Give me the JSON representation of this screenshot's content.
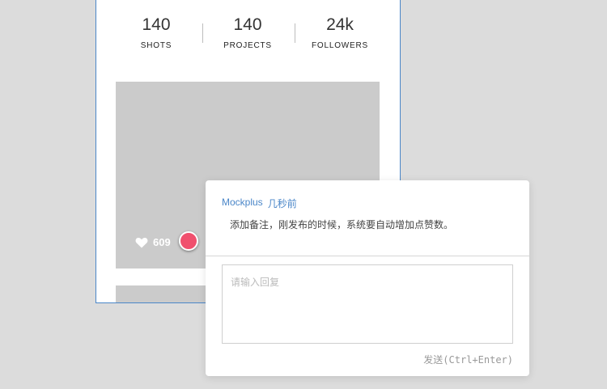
{
  "stats": [
    {
      "value": "140",
      "label": "SHOTS"
    },
    {
      "value": "140",
      "label": "PROJECTS"
    },
    {
      "value": "24k",
      "label": "FOLLOWERS"
    }
  ],
  "shot": {
    "likes": "609",
    "like_icon": "heart-icon"
  },
  "comment": {
    "author": "Mockplus",
    "time": "几秒前",
    "text": "添加备注，刚发布的时候，系统要自动增加点赞数。",
    "reply_placeholder": "请输入回复",
    "send_label": "发送(Ctrl+Enter)"
  },
  "colors": {
    "accent": "#4a86c8",
    "marker": "#f0506e",
    "placeholder_gray": "#cbcbcb"
  }
}
